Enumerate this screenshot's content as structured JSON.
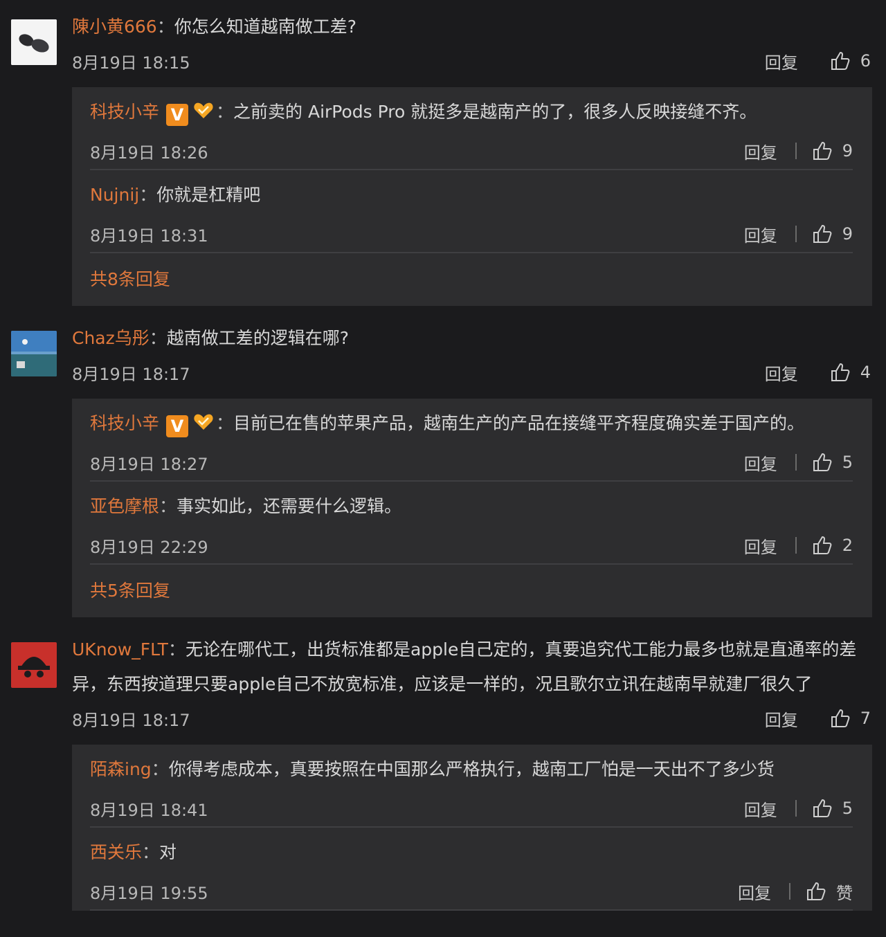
{
  "comments": [
    {
      "user": "陳小黄666",
      "text": "你怎么知道越南做工差?",
      "time": "8月19日 18:15",
      "reply_label": "回复",
      "likes": "6",
      "replies": [
        {
          "user": "科技小辛",
          "verified": true,
          "text": "之前卖的 AirPods Pro 就挺多是越南产的了，很多人反映接缝不齐。",
          "time": "8月19日 18:26",
          "reply_label": "回复",
          "likes": "9"
        },
        {
          "user": "Nujnij",
          "verified": false,
          "text": "你就是杠精吧",
          "time": "8月19日 18:31",
          "reply_label": "回复",
          "likes": "9"
        }
      ],
      "more": "共8条回复"
    },
    {
      "user": "Chaz乌彤",
      "text": "越南做工差的逻辑在哪?",
      "time": "8月19日 18:17",
      "reply_label": "回复",
      "likes": "4",
      "replies": [
        {
          "user": "科技小辛",
          "verified": true,
          "text": "目前已在售的苹果产品，越南生产的产品在接缝平齐程度确实差于国产的。",
          "time": "8月19日 18:27",
          "reply_label": "回复",
          "likes": "5"
        },
        {
          "user": "亚色摩根",
          "verified": false,
          "text": "事实如此，还需要什么逻辑。",
          "time": "8月19日 22:29",
          "reply_label": "回复",
          "likes": "2"
        }
      ],
      "more": "共5条回复"
    },
    {
      "user": "UKnow_FLT",
      "text": "无论在哪代工，出货标准都是apple自己定的，真要追究代工能力最多也就是直通率的差异，东西按道理只要apple自己不放宽标准，应该是一样的，况且歌尔立讯在越南早就建厂很久了",
      "time": "8月19日 18:17",
      "reply_label": "回复",
      "likes": "7",
      "replies": [
        {
          "user": "陌森ing",
          "verified": false,
          "text": "你得考虑成本，真要按照在中国那么严格执行，越南工厂怕是一天出不了多少货",
          "time": "8月19日 18:41",
          "reply_label": "回复",
          "likes": "5"
        },
        {
          "user": "西关乐",
          "verified": false,
          "text": "对",
          "time": "8月19日 19:55",
          "reply_label": "回复",
          "likes": "赞"
        }
      ],
      "more": ""
    }
  ],
  "colors": {
    "accent": "#e0783c",
    "background": "#1b1b1d",
    "panel": "#2d2d2f"
  },
  "icons": [
    "thumbs-up-icon",
    "verified-v-icon",
    "heart-badge-icon"
  ]
}
